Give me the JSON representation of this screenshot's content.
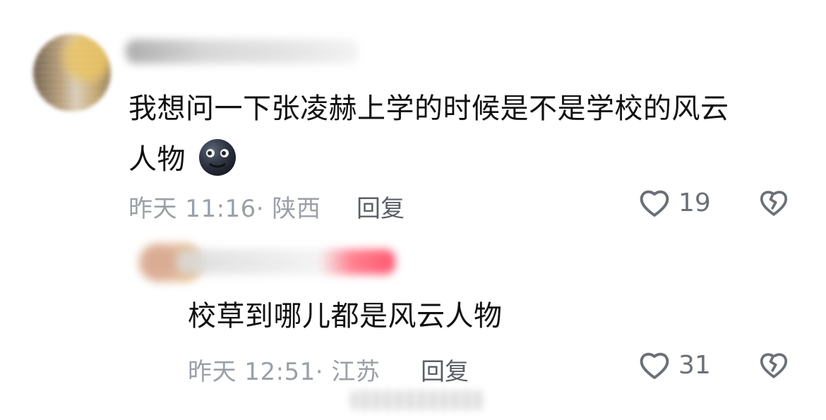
{
  "comment": {
    "text_line1": "我想问一下张凌赫上学的时候是不是学校的风云",
    "text_line2": "人物",
    "emoji": "new-moon-face-icon",
    "meta": "昨天 11:16· 陕西",
    "reply_label": "回复",
    "likes": "19"
  },
  "reply": {
    "text": "校草到哪儿都是风云人物",
    "meta": "昨天 12:51· 江苏",
    "reply_label": "回复",
    "likes": "31"
  },
  "icons": {
    "like": "heart-icon",
    "dislike": "broken-heart-icon"
  },
  "colors": {
    "text_primary": "#111111",
    "meta_gray": "#9aa0a6",
    "icon_gray": "#6b7077"
  }
}
